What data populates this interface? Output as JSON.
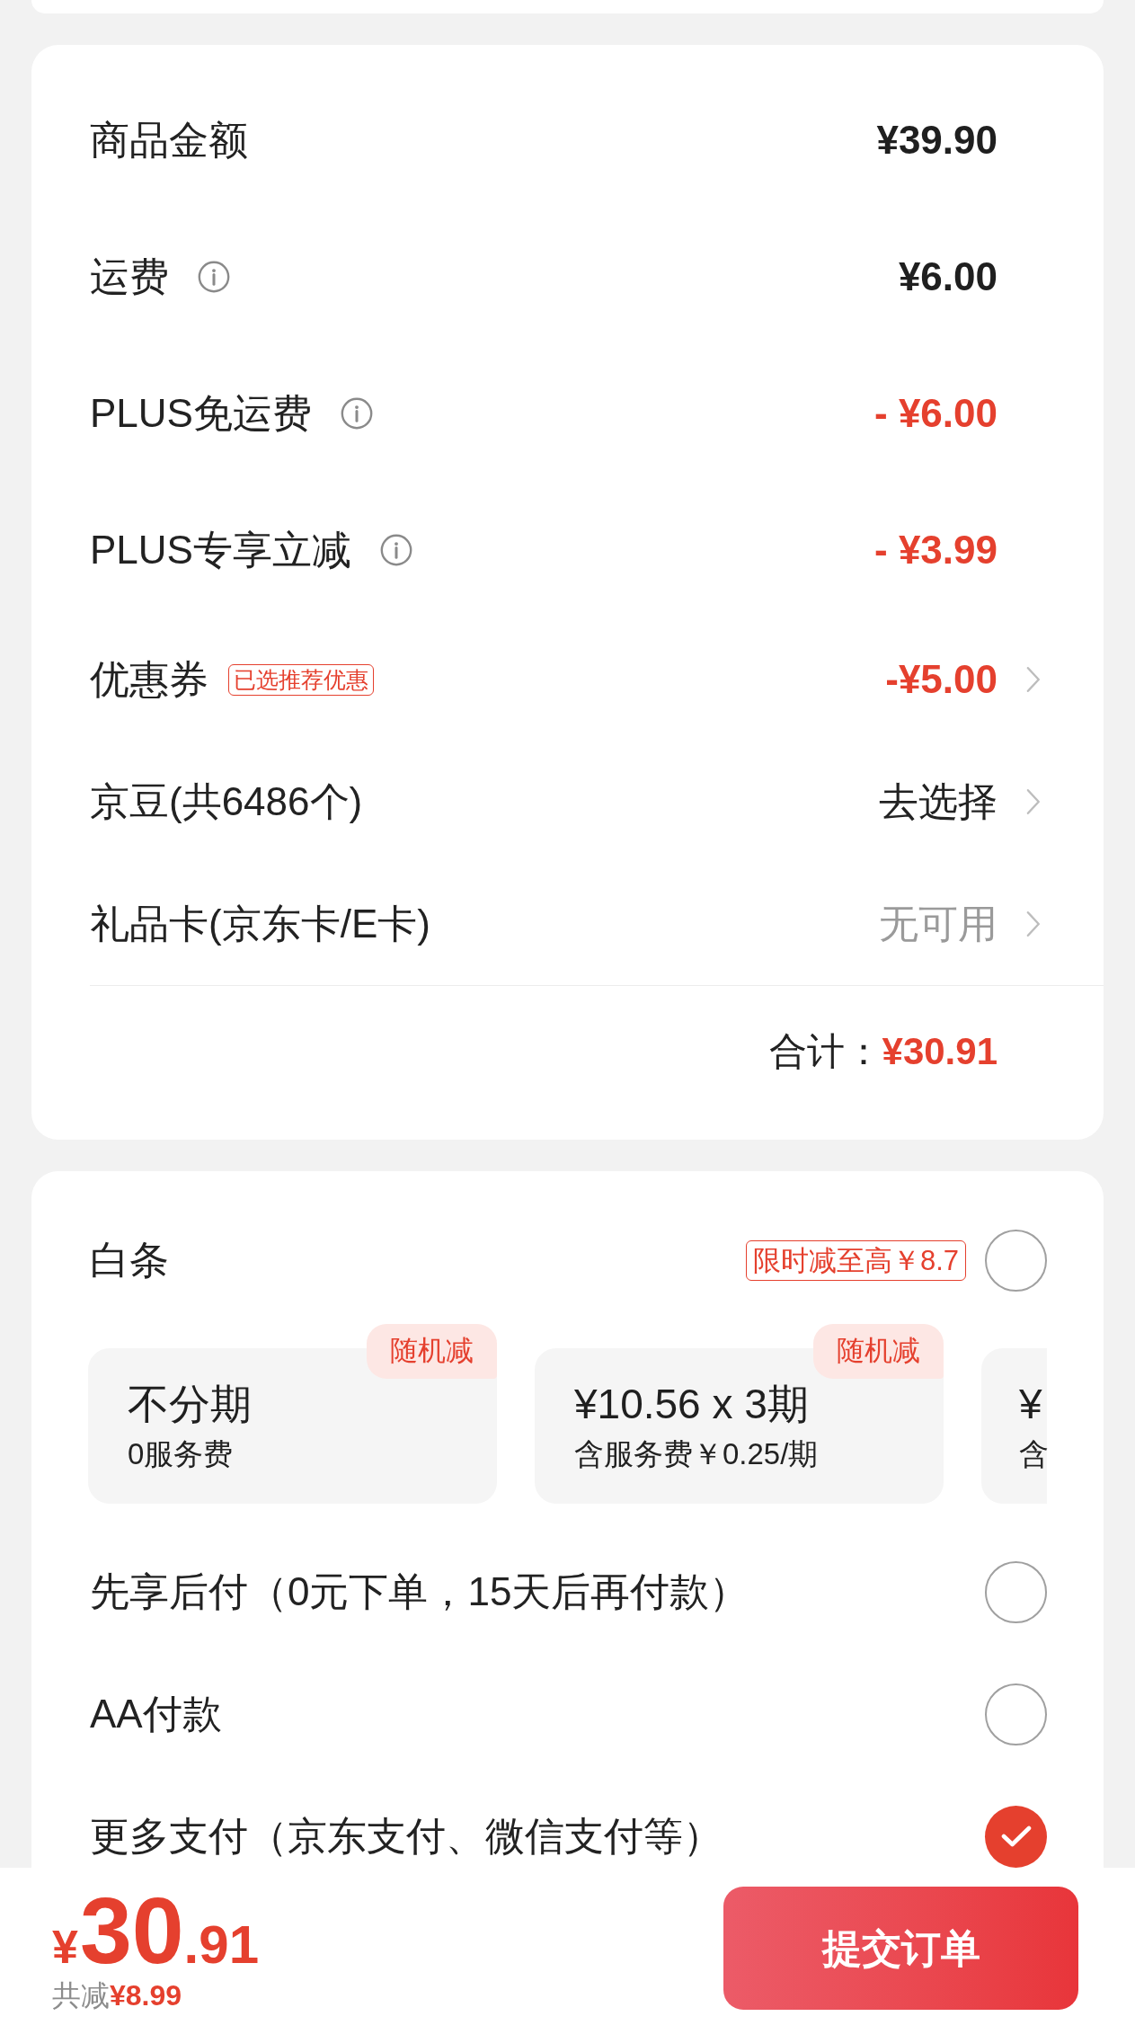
{
  "price_summary": {
    "rows": [
      {
        "label": "商品金额",
        "info": false,
        "value": "¥39.90",
        "kind": "amount",
        "chevron": false
      },
      {
        "label": "运费",
        "info": true,
        "value": "¥6.00",
        "kind": "amount",
        "chevron": false
      },
      {
        "label": "PLUS免运费",
        "info": true,
        "value": "- ¥6.00",
        "kind": "discount",
        "chevron": false
      },
      {
        "label": "PLUS专享立减",
        "info": true,
        "value": "- ¥3.99",
        "kind": "discount",
        "chevron": false
      },
      {
        "label": "优惠券",
        "info": false,
        "badge": "已选推荐优惠",
        "value": "-¥5.00",
        "kind": "discount",
        "chevron": true
      },
      {
        "label": "京豆(共6486个)",
        "info": false,
        "value": "去选择",
        "kind": "action",
        "chevron": true
      },
      {
        "label": "礼品卡(京东卡/E卡)",
        "info": false,
        "value": "无可用",
        "kind": "unavailable",
        "chevron": true
      }
    ],
    "total": {
      "label": "合计：",
      "value": "¥30.91"
    }
  },
  "payment": {
    "baitiao": {
      "label": "白条",
      "promo": "限时减至高￥8.7",
      "selected": false,
      "plans": [
        {
          "title": "不分期",
          "subtitle": "0服务费",
          "tag": "随机减",
          "selected": false
        },
        {
          "title": "¥10.56 x 3期",
          "subtitle": "含服务费￥0.25/期",
          "tag": "随机减",
          "selected": false
        },
        {
          "title": "¥",
          "subtitle": "含",
          "selected": false
        }
      ]
    },
    "options": [
      {
        "label": "先享后付（0元下单，15天后再付款）",
        "selected": false
      },
      {
        "label": "AA付款",
        "selected": false
      },
      {
        "label": "更多支付（京东支付、微信支付等）",
        "selected": true
      }
    ]
  },
  "footer": {
    "price": {
      "currency": "¥",
      "integer": "30",
      "decimals": ".91"
    },
    "savings": {
      "label": "共减",
      "value": "¥8.99"
    },
    "submit": "提交订单"
  }
}
